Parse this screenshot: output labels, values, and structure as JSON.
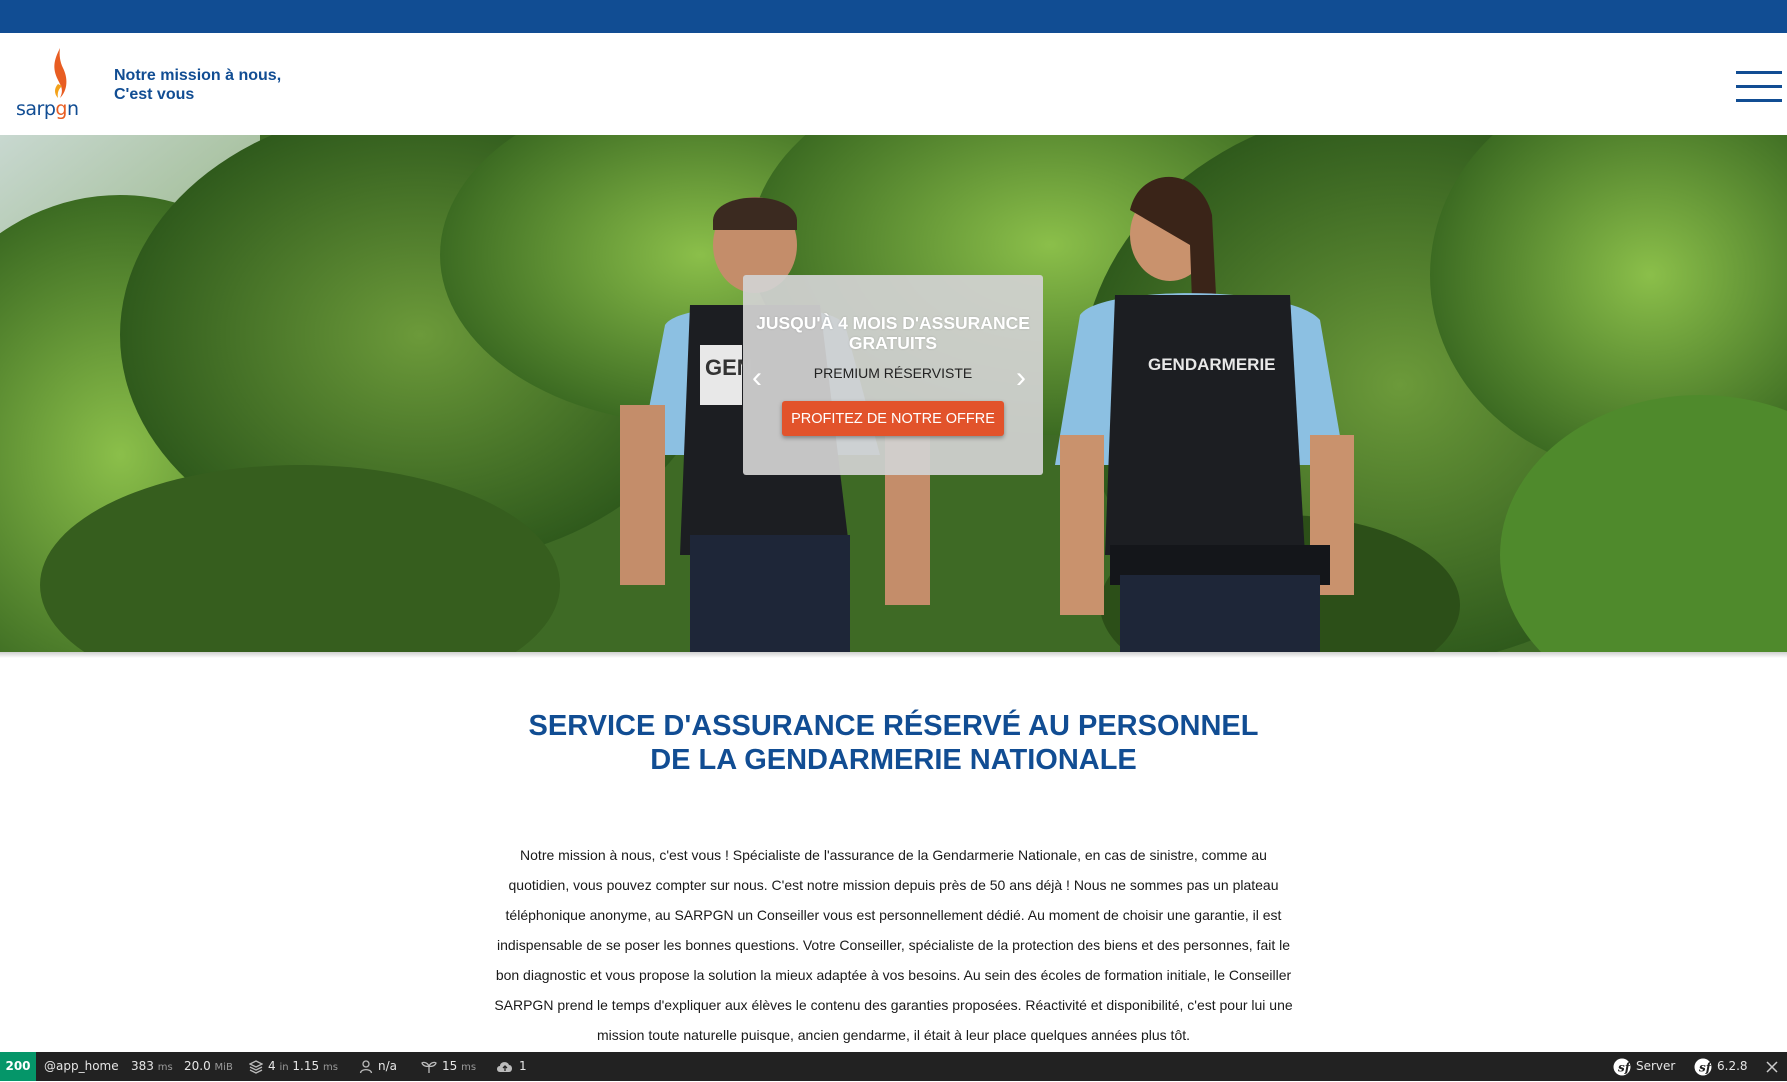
{
  "header": {
    "logo_text_part1": "sarp",
    "logo_text_part2": "g",
    "logo_text_part3": "n",
    "tagline_line1": "Notre mission à nous,",
    "tagline_line2": "C'est vous",
    "menu_icon": "hamburger-menu-icon"
  },
  "hero": {
    "promo_title_line1": "JUSQU'À 4 MOIS D'ASSURANCE",
    "promo_title_line2": "GRATUITS",
    "promo_subtitle": "PREMIUM RÉSERVISTE",
    "promo_button": "PROFITEZ DE NOTRE OFFRE",
    "prev_arrow": "‹",
    "next_arrow": "›",
    "badge_left": "GEN",
    "badge_right": "GENDARMERIE"
  },
  "main": {
    "title_line1": "SERVICE D'ASSURANCE RÉSERVÉ AU PERSONNEL",
    "title_line2": "DE LA GENDARMERIE NATIONALE",
    "paragraph_lines": [
      "Notre mission à nous, c'est vous ! Spécialiste de l'assurance de la Gendarmerie Nationale, en cas de sinistre, comme au",
      "quotidien, vous pouvez compter sur nous. C'est notre mission depuis près de 50 ans déjà ! Nous ne sommes pas un plateau",
      "téléphonique anonyme, au SARPGN un Conseiller vous est personnellement dédié. Au moment de choisir une garantie, il est",
      "indispensable de se poser les bonnes questions. Votre Conseiller, spécialiste de la protection des biens et des personnes, fait le",
      "bon diagnostic et vous propose la solution la mieux adaptée à vos besoins. Au sein des écoles de formation initiale, le Conseiller",
      "SARPGN prend le temps d'expliquer aux élèves le contenu des garanties proposées. Réactivité et disponibilité, c'est pour lui une",
      "mission toute naturelle puisque, ancien gendarme, il était à leur place quelques années plus tôt."
    ]
  },
  "debugbar": {
    "status": "200",
    "route": "@app_home",
    "time_value": "383",
    "time_unit": "ms",
    "memory_value": "20.0",
    "memory_unit": "MiB",
    "twig_count": "4",
    "twig_in": "in",
    "twig_time": "1.15",
    "twig_unit": "ms",
    "user": "n/a",
    "cache_value": "15",
    "cache_unit": "ms",
    "http_count": "1",
    "server_label": "Server",
    "symfony_version": "6.2.8",
    "colors": {
      "status": "#059669",
      "bar": "#222222"
    }
  },
  "colors": {
    "brand_blue": "#114d93",
    "accent_orange": "#e2532b"
  }
}
